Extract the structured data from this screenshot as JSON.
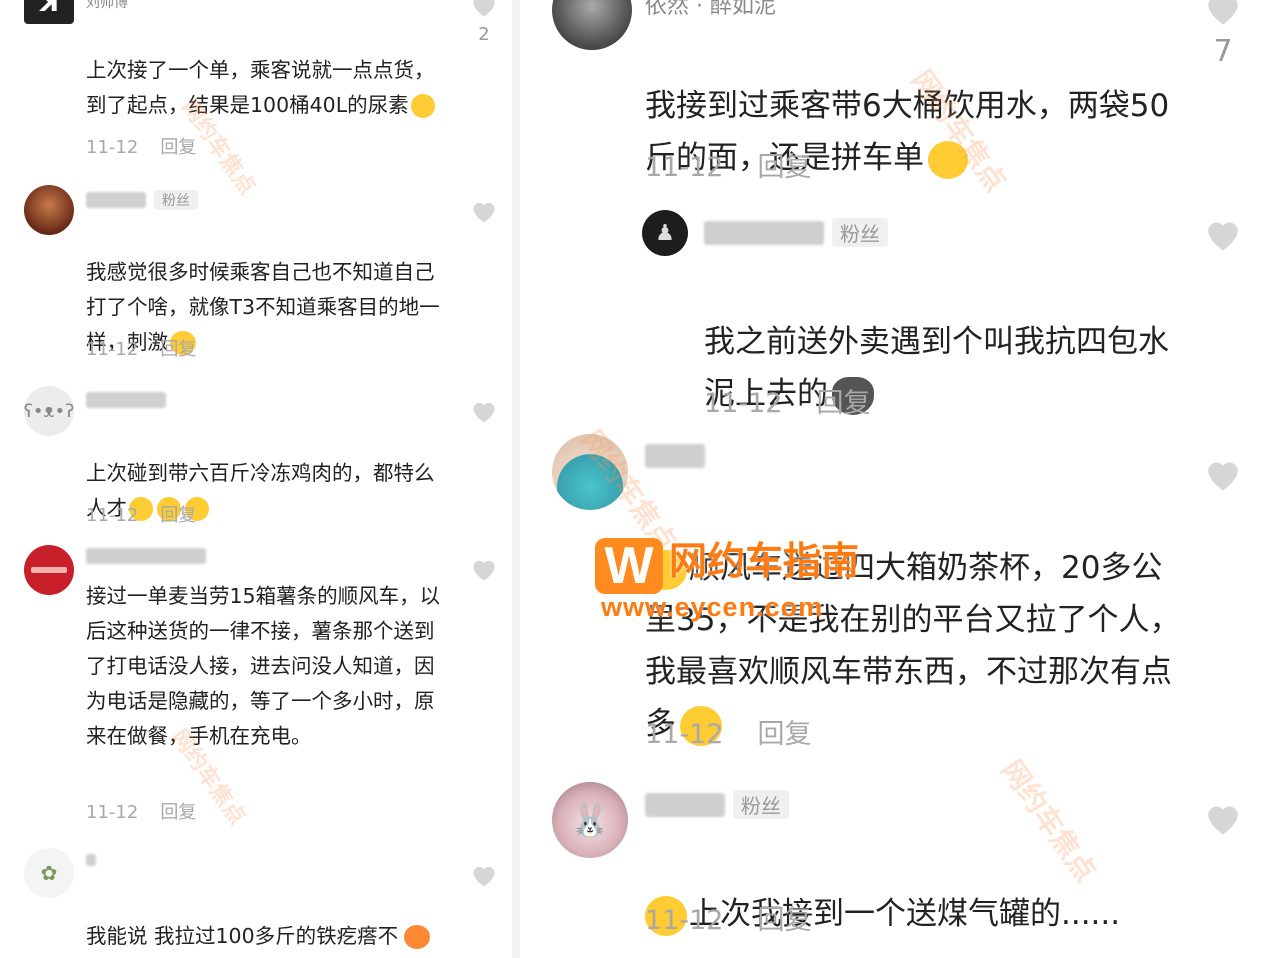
{
  "left": {
    "top_comment": {
      "author": "刘帅博",
      "text": "上次接了一个单，乘客说就一点点货，到了起点，结果是100桶40L的尿素",
      "date": "11-12",
      "reply": "回复",
      "likes": "2"
    },
    "comments": [
      {
        "badge": "粉丝",
        "text": "我感觉很多时候乘客自己也不知道自己打了个啥，就像T3不知道乘客目的地一样，刺激",
        "date": "11-12",
        "reply": "回复"
      },
      {
        "badge": "",
        "text": "上次碰到带六百斤冷冻鸡肉的，都特么人才",
        "date": "11-12",
        "reply": "回复"
      },
      {
        "badge": "",
        "text": "接过一单麦当劳15箱薯条的顺风车，以后这种送货的一律不接，薯条那个送到了打电话没人接，进去问没人知道，因为电话是隐藏的，等了一个多小时，原来在做餐，手机在充电。",
        "date": "11-12",
        "reply": "回复"
      },
      {
        "badge": "",
        "text": "我能说 我拉过100多斤的铁疙瘩不",
        "date": "",
        "reply": ""
      }
    ]
  },
  "right": {
    "top_comment": {
      "author": "依然 · 醉如泥",
      "text": "我接到过乘客带6大桶饮用水，两袋50斤的面，还是拼车单",
      "date": "11-12",
      "reply": "回复",
      "likes": "7"
    },
    "nested_reply": {
      "badge": "粉丝",
      "text": "我之前送外卖遇到个叫我抗四包水泥上去的",
      "date": "11-12",
      "reply": "回复"
    },
    "comments": [
      {
        "badge": "",
        "text": "顺风车送过四大箱奶茶杯，20多公里35，不是我在别的平台又拉了个人，我最喜欢顺风车带东西，不过那次有点多",
        "date": "11-12",
        "reply": "回复"
      },
      {
        "badge": "粉丝",
        "text": "上次我接到一个送煤气罐的......",
        "date": "11-12",
        "reply": "回复"
      }
    ]
  },
  "watermark": {
    "brand": "网约车指南",
    "url": "www.eycen.com",
    "diagonal": "网约车焦点"
  },
  "colors": {
    "heart": "#d6d6d6",
    "meta": "#a8a8a8",
    "brand": "#ff7a10"
  }
}
